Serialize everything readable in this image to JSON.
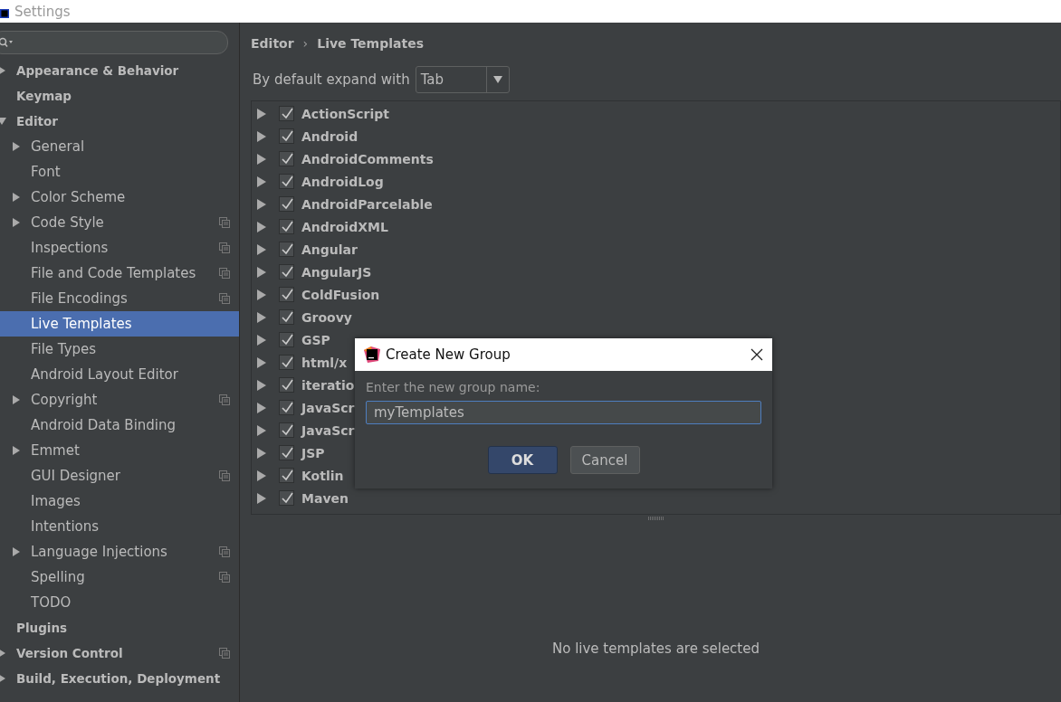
{
  "window": {
    "title": "Settings"
  },
  "sidebar": {
    "items": [
      {
        "label": "Appearance & Behavior",
        "expanded": false,
        "selected": false
      },
      {
        "label": "Keymap",
        "selected": false
      },
      {
        "label": "Editor",
        "expanded": true,
        "selected": false,
        "children": [
          {
            "label": "General",
            "expanded": false,
            "selected": false
          },
          {
            "label": "Font",
            "selected": false
          },
          {
            "label": "Color Scheme",
            "expanded": false,
            "selected": false
          },
          {
            "label": "Code Style",
            "expanded": false,
            "selected": false,
            "project_icon": true
          },
          {
            "label": "Inspections",
            "selected": false,
            "project_icon": true
          },
          {
            "label": "File and Code Templates",
            "selected": false,
            "project_icon": true
          },
          {
            "label": "File Encodings",
            "selected": false,
            "project_icon": true
          },
          {
            "label": "Live Templates",
            "selected": true
          },
          {
            "label": "File Types",
            "selected": false
          },
          {
            "label": "Android Layout Editor",
            "selected": false
          },
          {
            "label": "Copyright",
            "expanded": false,
            "selected": false,
            "project_icon": true
          },
          {
            "label": "Android Data Binding",
            "selected": false
          },
          {
            "label": "Emmet",
            "expanded": false,
            "selected": false
          },
          {
            "label": "GUI Designer",
            "selected": false,
            "project_icon": true
          },
          {
            "label": "Images",
            "selected": false
          },
          {
            "label": "Intentions",
            "selected": false
          },
          {
            "label": "Language Injections",
            "expanded": false,
            "selected": false,
            "project_icon": true
          },
          {
            "label": "Spelling",
            "selected": false,
            "project_icon": true
          },
          {
            "label": "TODO",
            "selected": false
          }
        ]
      },
      {
        "label": "Plugins",
        "selected": false
      },
      {
        "label": "Version Control",
        "expanded": false,
        "selected": false,
        "project_icon": true
      },
      {
        "label": "Build, Execution, Deployment",
        "expanded": false,
        "selected": false
      }
    ]
  },
  "breadcrumb": [
    "Editor",
    "Live Templates"
  ],
  "breadcrumb_separator": "›",
  "expand_with": {
    "label": "By default expand with",
    "value": "Tab"
  },
  "template_groups": [
    {
      "label": "ActionScript",
      "checked": true
    },
    {
      "label": "Android",
      "checked": true
    },
    {
      "label": "AndroidComments",
      "checked": true
    },
    {
      "label": "AndroidLog",
      "checked": true
    },
    {
      "label": "AndroidParcelable",
      "checked": true
    },
    {
      "label": "AndroidXML",
      "checked": true
    },
    {
      "label": "Angular",
      "checked": true
    },
    {
      "label": "AngularJS",
      "checked": true
    },
    {
      "label": "ColdFusion",
      "checked": true
    },
    {
      "label": "Groovy",
      "checked": true
    },
    {
      "label": "GSP",
      "checked": true
    },
    {
      "label": "html/x",
      "checked": true
    },
    {
      "label": "iteratio",
      "checked": true
    },
    {
      "label": "JavaScr",
      "checked": true
    },
    {
      "label": "JavaScr",
      "checked": true
    },
    {
      "label": "JSP",
      "checked": true
    },
    {
      "label": "Kotlin",
      "checked": true
    },
    {
      "label": "Maven",
      "checked": true
    }
  ],
  "empty_message": "No live templates are selected",
  "dialog": {
    "title": "Create New Group",
    "prompt": "Enter the new group name:",
    "value": "myTemplates",
    "buttons": [
      {
        "label": "OK",
        "primary": true
      },
      {
        "label": "Cancel",
        "primary": false
      }
    ]
  }
}
